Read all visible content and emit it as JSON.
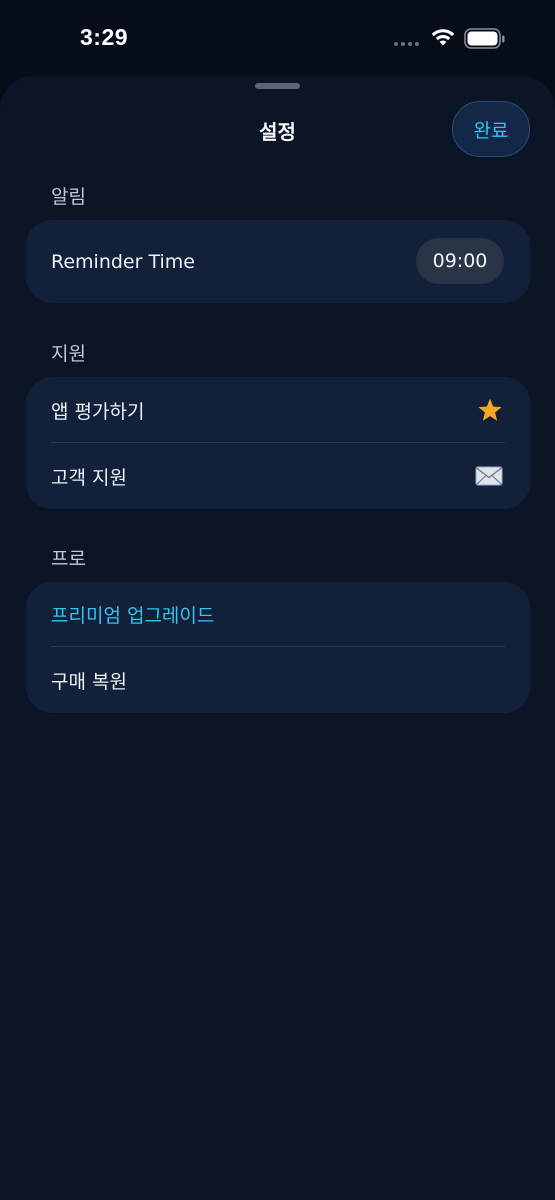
{
  "status_bar": {
    "time": "3:29",
    "icons": [
      "signal-dots-icon",
      "wifi-icon",
      "battery-icon"
    ]
  },
  "sheet": {
    "title": "설정",
    "done_label": "완료"
  },
  "sections": {
    "notifications": {
      "header": "알림",
      "reminder_label": "Reminder Time",
      "reminder_value": "09:00"
    },
    "support": {
      "header": "지원",
      "rate_label": "앱 평가하기",
      "rate_icon": "star-icon",
      "contact_label": "고객 지원",
      "contact_icon": "envelope-icon"
    },
    "pro": {
      "header": "프로",
      "upgrade_label": "프리미엄 업그레이드",
      "restore_label": "구매 복원"
    }
  },
  "colors": {
    "background": "#070d18",
    "sheet": "#0b1526",
    "card": "#12203a",
    "accent": "#31c4f3",
    "star": "#f5a623"
  }
}
